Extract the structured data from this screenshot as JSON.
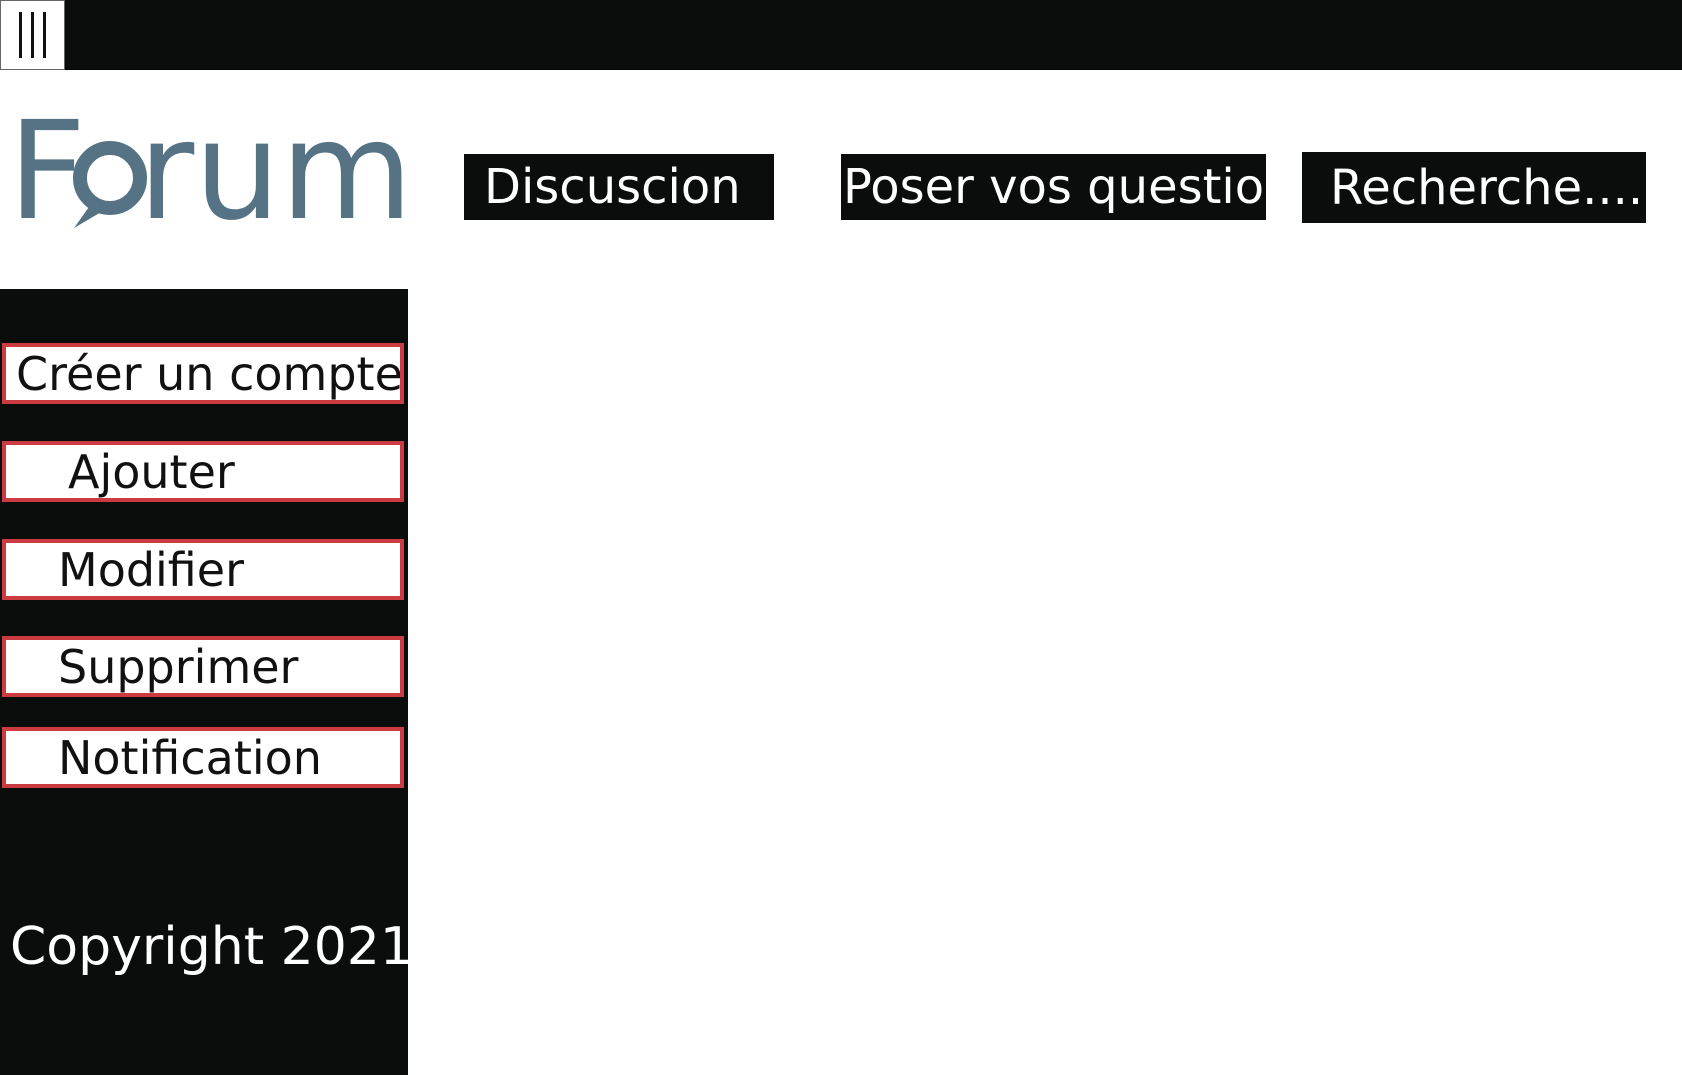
{
  "header": {
    "menu_icon": "hamburger-vertical-icon"
  },
  "logo": {
    "text": "Forum",
    "color": "#567385"
  },
  "nav": {
    "discussion_label": "Discuscion",
    "question_label": "Poser vos question",
    "search_label": "Recherche......."
  },
  "sidebar": {
    "items": [
      {
        "label": "Créer un compte"
      },
      {
        "label": "Ajouter"
      },
      {
        "label": "Modifier"
      },
      {
        "label": "Supprimer"
      },
      {
        "label": "Notification"
      }
    ],
    "copyright": "Copyright 2021"
  },
  "colors": {
    "bar_background": "#0b0c0c",
    "item_border": "#cc3b42",
    "logo": "#567385"
  }
}
